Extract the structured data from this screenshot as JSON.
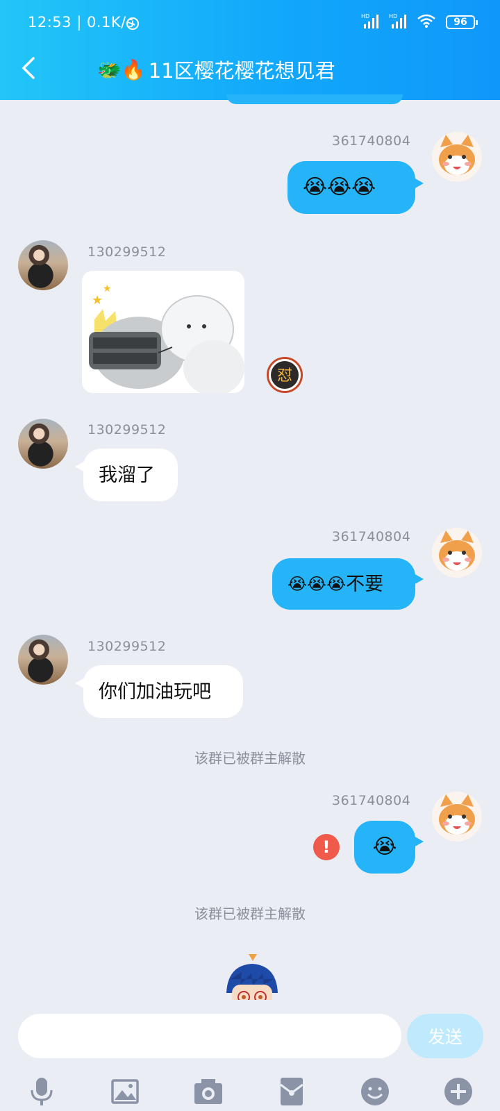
{
  "status_bar": {
    "time": "12:53 | 0.1K/s",
    "battery": "96"
  },
  "header": {
    "title": "11区樱花樱花想见君",
    "title_emoji": "🐲🔥"
  },
  "messages": [
    {
      "direction": "out",
      "sender": "361740804",
      "text": "😭😭😭"
    },
    {
      "direction": "in",
      "sender": "130299512",
      "type": "sticker"
    },
    {
      "direction": "in",
      "sender": "130299512",
      "text": "我溜了"
    },
    {
      "direction": "out",
      "sender": "361740804",
      "emoji": "😭😭😭",
      "text": "不要"
    },
    {
      "direction": "in",
      "sender": "130299512",
      "text": "你们加油玩吧"
    },
    {
      "direction": "system",
      "text": "该群已被群主解散"
    },
    {
      "direction": "out",
      "sender": "361740804",
      "text": "😭",
      "failed": true
    },
    {
      "direction": "system",
      "text": "该群已被群主解散"
    }
  ],
  "sticker_badge": "怼",
  "error_mark": "!",
  "input": {
    "placeholder": "",
    "send_label": "发送"
  },
  "toolbar": [
    "microphone-icon",
    "image-icon",
    "camera-icon",
    "red-packet-icon",
    "emoji-icon",
    "plus-icon"
  ],
  "colors": {
    "header_start": "#22c6f8",
    "header_end": "#0f98fa",
    "bubble_out": "#25b4f7",
    "bubble_in": "#ffffff",
    "background": "#eaedf4",
    "send_button": "#bfe9fc",
    "error": "#ef5a4a"
  }
}
